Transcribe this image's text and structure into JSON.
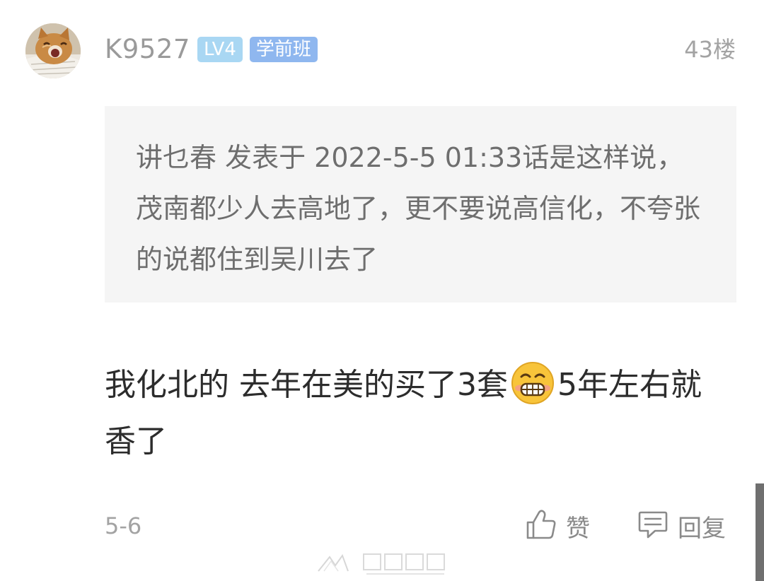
{
  "post": {
    "username": "K9527",
    "level_badge": "LV4",
    "title_badge": "学前班",
    "floor": "43楼",
    "quote": "讲乜春 发表于 2022-5-5 01:33话是这样说，茂南都少人去高地了，更不要说高信化，不夸张的说都住到吴川去了",
    "body_before_emoji": "我化北的 去年在美的买了3套",
    "body_after_emoji": "5年左右就香了",
    "date": "5-6",
    "like_label": "赞",
    "reply_label": "回复"
  },
  "colors": {
    "level_badge_bg": "#a9d7f3",
    "title_badge_bg": "#8fb7ef",
    "quote_bg": "#f5f5f5",
    "emoji_face": "#f8c43a"
  },
  "icons": {
    "avatar": "kitten-avatar",
    "emoji": "grinning-blush-emoji",
    "like": "thumbs-up-icon",
    "reply": "comment-bubble-icon",
    "watermark": "gdmm-logo"
  }
}
